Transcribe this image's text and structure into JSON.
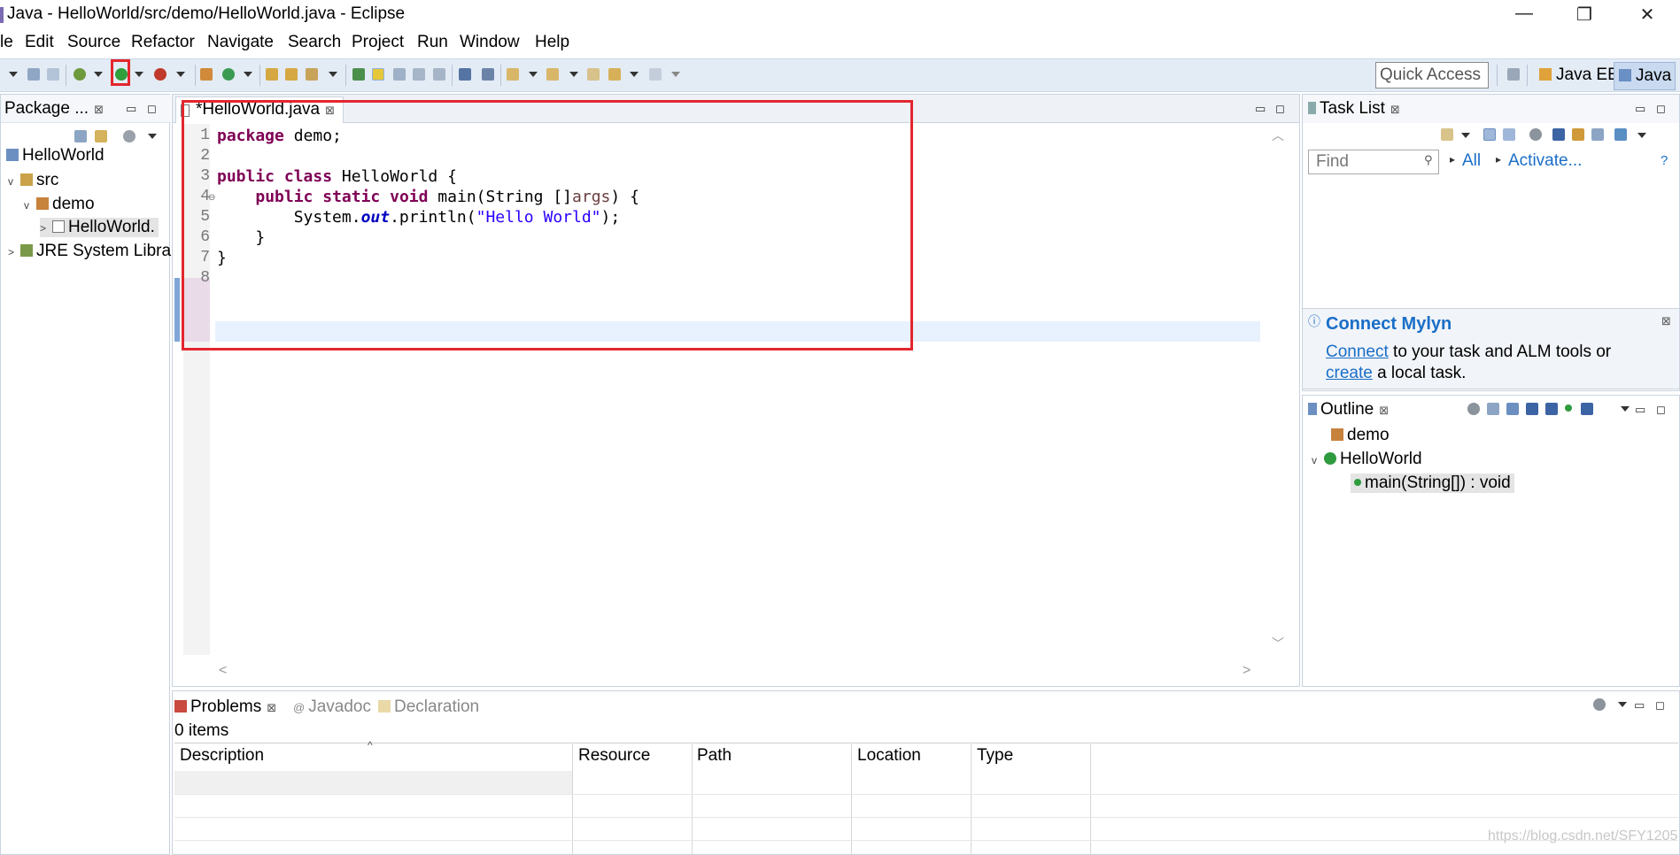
{
  "window": {
    "title": "Java - HelloWorld/src/demo/HelloWorld.java - Eclipse",
    "minimize": "—",
    "restore": "❐",
    "close": "✕"
  },
  "menu": [
    "le",
    "Edit",
    "Source",
    "Refactor",
    "Navigate",
    "Search",
    "Project",
    "Run",
    "Window",
    "Help"
  ],
  "toolbar": {
    "quick_access_placeholder": "Quick Access",
    "perspectives": [
      "Java EE",
      "Java"
    ],
    "accent": "#e3262e"
  },
  "package_explorer": {
    "tab": "Package ...",
    "tree": [
      {
        "label": "HelloWorld",
        "level": 0,
        "twisty": ""
      },
      {
        "label": "src",
        "level": 1,
        "twisty": "v"
      },
      {
        "label": "demo",
        "level": 2,
        "twisty": "v"
      },
      {
        "label": "HelloWorld.",
        "level": 3,
        "twisty": ">"
      },
      {
        "label": "JRE System Libra",
        "level": 1,
        "twisty": ">"
      }
    ]
  },
  "editor": {
    "tab": "*HelloWorld.java",
    "line_numbers": [
      "1",
      "2",
      "3",
      "4",
      "5",
      "6",
      "7",
      "8"
    ],
    "code": [
      "package demo;",
      "",
      "public class HelloWorld {",
      "    public static void main(String []args) {",
      "        System.out.println(\"Hello World\");",
      "    }",
      "}",
      ""
    ]
  },
  "task_list": {
    "tab": "Task List",
    "find_placeholder": "Find",
    "all": "All",
    "activate": "Activate...",
    "mylyn_title": "Connect Mylyn",
    "mylyn_connect": "Connect",
    "mylyn_text1": " to your task and ALM tools or",
    "mylyn_create": "create",
    "mylyn_text2": " a local task."
  },
  "outline": {
    "tab": "Outline",
    "items": [
      "demo",
      "HelloWorld",
      "main(String[]) : void"
    ]
  },
  "problems": {
    "tabs": [
      "Problems",
      "Javadoc",
      "Declaration"
    ],
    "count": "0 items",
    "columns": [
      "Description",
      "Resource",
      "Path",
      "Location",
      "Type"
    ]
  },
  "watermark": "https://blog.csdn.net/SFY1205"
}
